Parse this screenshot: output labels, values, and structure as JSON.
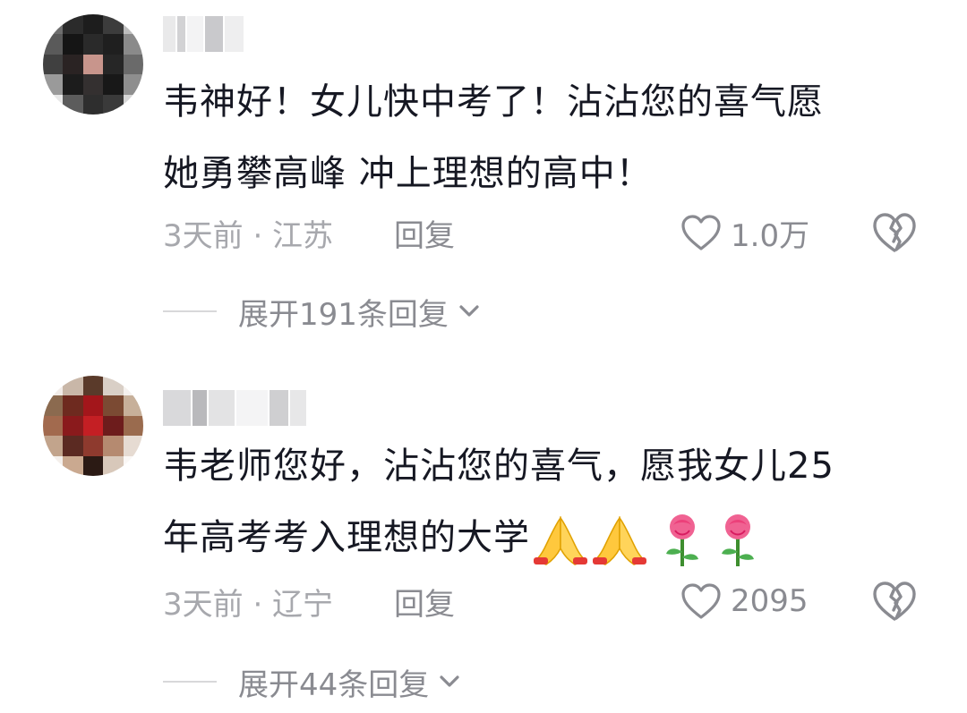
{
  "comments": [
    {
      "text_line1": "韦神好！女儿快中考了！沾沾您的喜气愿",
      "text_line2": "她勇攀高峰 冲上理想的高中！",
      "meta": "3天前 · 江苏",
      "reply_label": "回复",
      "likes": "1.0万",
      "expand_label": "展开191条回复"
    },
    {
      "text_line1": "韦老师您好，沾沾您的喜气，愿我女儿25",
      "text_line2": "年高考考入理想的大学",
      "meta": "3天前 · 辽宁",
      "reply_label": "回复",
      "likes": "2095",
      "expand_label": "展开44条回复"
    }
  ],
  "icons": {
    "like": "heart-outline-icon",
    "dislike": "broken-heart-icon",
    "expand": "chevron-down-icon",
    "emoji_pray": "folded-hands-emoji",
    "emoji_rose": "rose-emoji"
  },
  "colors": {
    "text": "#161823",
    "meta": "#a7a8ad",
    "secondary": "#8a8b91"
  }
}
